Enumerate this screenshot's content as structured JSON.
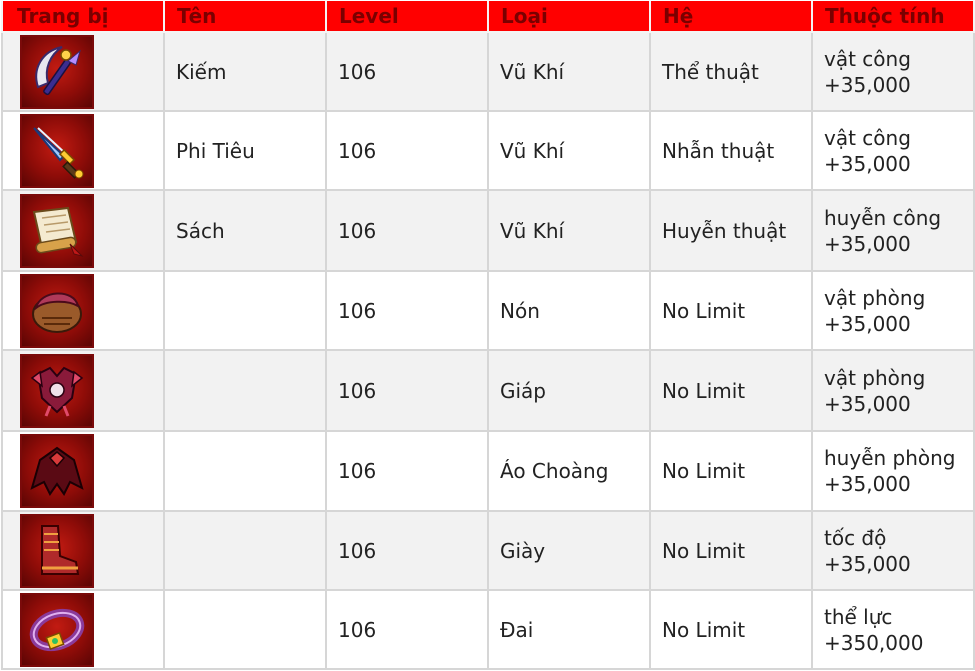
{
  "headers": {
    "equipment": "Trang bị",
    "name": "Tên",
    "level": "Level",
    "type": "Loại",
    "school": "Hệ",
    "attribute": "Thuộc tính"
  },
  "rows": [
    {
      "icon": "sickle-weapon-icon",
      "name": "Kiếm",
      "level": "106",
      "type": "Vũ Khí",
      "school": "Thể thuật",
      "attr_name": "vật công",
      "attr_value": "+35,000"
    },
    {
      "icon": "dagger-weapon-icon",
      "name": "Phi Tiêu",
      "level": "106",
      "type": "Vũ Khí",
      "school": "Nhẫn thuật",
      "attr_name": "vật công",
      "attr_value": "+35,000"
    },
    {
      "icon": "scroll-book-icon",
      "name": "Sách",
      "level": "106",
      "type": "Vũ Khí",
      "school": "Huyễn thuật",
      "attr_name": "huyễn công",
      "attr_value": "+35,000"
    },
    {
      "icon": "hat-icon",
      "name": "",
      "level": "106",
      "type": "Nón",
      "school": "No Limit",
      "attr_name": "vật phòng",
      "attr_value": "+35,000"
    },
    {
      "icon": "armor-icon",
      "name": "",
      "level": "106",
      "type": "Giáp",
      "school": "No Limit",
      "attr_name": "vật phòng",
      "attr_value": "+35,000"
    },
    {
      "icon": "cloak-icon",
      "name": "",
      "level": "106",
      "type": "Áo Choàng",
      "school": "No Limit",
      "attr_name": "huyễn phòng",
      "attr_value": "+35,000"
    },
    {
      "icon": "boots-icon",
      "name": "",
      "level": "106",
      "type": "Giày",
      "school": "No Limit",
      "attr_name": "tốc độ",
      "attr_value": "+35,000"
    },
    {
      "icon": "belt-icon",
      "name": "",
      "level": "106",
      "type": "Đai",
      "school": "No Limit",
      "attr_name": "thể lực",
      "attr_value": "+350,000"
    }
  ],
  "colors": {
    "header_bg": "#ff0000",
    "header_text": "#7a0000",
    "row_alt_bg": "#f2f2f2",
    "grid": "#d6d6d6"
  }
}
